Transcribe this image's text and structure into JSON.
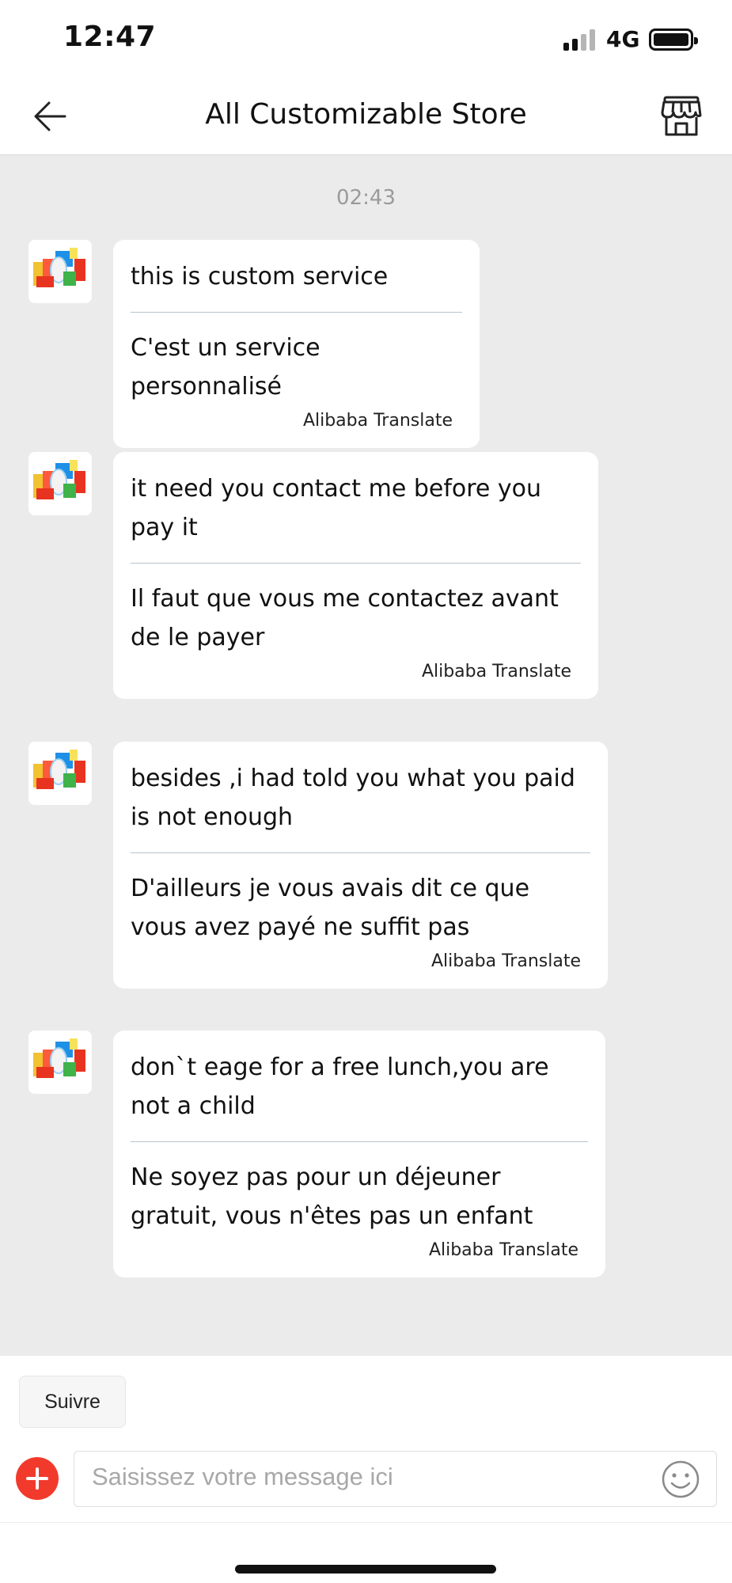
{
  "status_bar": {
    "time": "12:47",
    "network": "4G",
    "icons": [
      "signal-icon",
      "battery-icon"
    ]
  },
  "header": {
    "title": "All Customizable Store",
    "back_icon": "back-arrow-icon",
    "store_icon": "storefront-icon"
  },
  "chat": {
    "timestamp": "02:43",
    "messages": [
      {
        "text": "this is custom service",
        "translation": "C'est un service personnalisé",
        "translator": "Alibaba Translate"
      },
      {
        "text": "it need you contact me before you pay it",
        "translation": "Il faut que vous me contactez avant de le payer",
        "translator": "Alibaba Translate"
      },
      {
        "text": "besides ,i had told you what you paid is not enough",
        "translation": "D'ailleurs je vous avais dit ce que vous avez payé ne suffit pas",
        "translator": "Alibaba Translate"
      },
      {
        "text": "don`t eage for a free lunch,you are not a child",
        "translation": "Ne soyez pas pour un déjeuner gratuit, vous n'êtes pas un enfant",
        "translator": "Alibaba Translate"
      }
    ]
  },
  "bottom": {
    "follow_label": "Suivre",
    "input_placeholder": "Saisissez votre message ici",
    "add_icon": "plus-icon",
    "emoji_icon": "emoji-icon"
  },
  "colors": {
    "accent": "#f23a2c",
    "chat_background": "#ebebeb",
    "bubble": "#ffffff"
  }
}
